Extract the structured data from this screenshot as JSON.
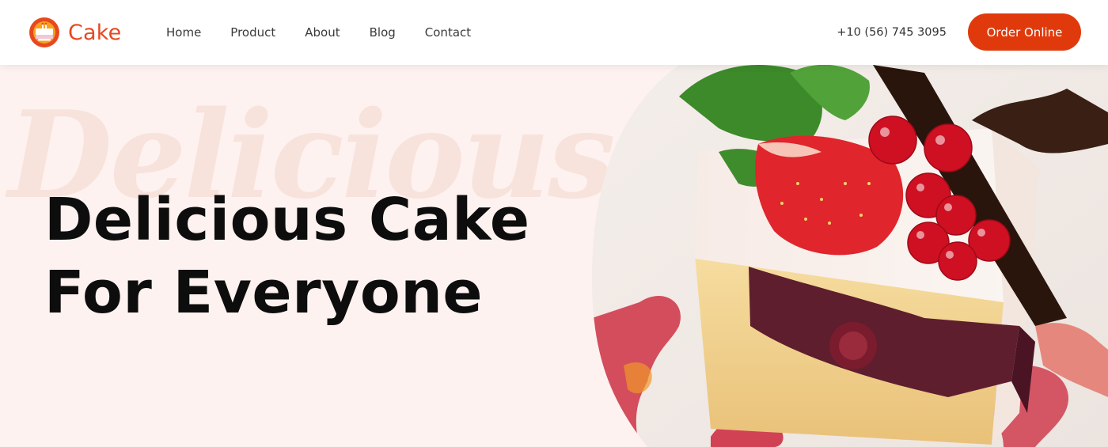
{
  "brand": {
    "name": "Cake",
    "color": "#e8481f",
    "logo_icon": "cake-slice-icon"
  },
  "nav": {
    "items": [
      "Home",
      "Product",
      "About",
      "Blog",
      "Contact"
    ]
  },
  "contact": {
    "phone": "+10 (56) 745 3095"
  },
  "cta": {
    "label": "Order Online",
    "color": "#e03a0c"
  },
  "hero": {
    "watermark": "Delicious",
    "headline_line1": "Delicious Cake",
    "headline_line2": "For Everyone",
    "background": "#fdf2f0",
    "image_subject": "cake-slice-with-berries-photo"
  }
}
